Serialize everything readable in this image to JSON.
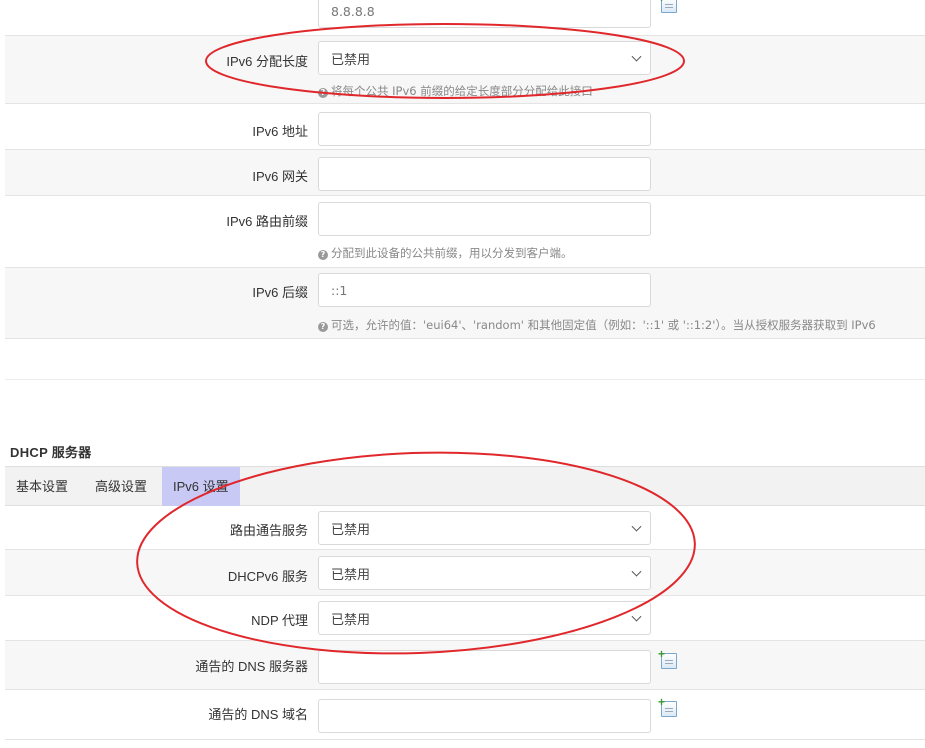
{
  "top_fields": {
    "dns_value": "8.8.8.8",
    "ipv6_assign": {
      "label": "IPv6 分配长度",
      "value": "已禁用",
      "hint": "将每个公共 IPv6 前缀的给定长度部分分配给此接口"
    },
    "ipv6_addr": {
      "label": "IPv6 地址",
      "value": ""
    },
    "ipv6_gw": {
      "label": "IPv6 网关",
      "value": ""
    },
    "ipv6_prefix": {
      "label": "IPv6 路由前缀",
      "value": "",
      "hint": "分配到此设备的公共前缀，用以分发到客户端。"
    },
    "ipv6_suffix": {
      "label": "IPv6 后缀",
      "value": "::1",
      "hint": "可选，允许的值：'eui64'、'random' 和其他固定值（例如：'::1' 或 '::1:2'）。当从授权服务器获取到 IPv6"
    }
  },
  "dhcp": {
    "title": "DHCP 服务器",
    "tabs": [
      "基本设置",
      "高级设置",
      "IPv6 设置"
    ],
    "active_tab": "IPv6 设置",
    "ra_service": {
      "label": "路由通告服务",
      "value": "已禁用"
    },
    "dhcpv6_service": {
      "label": "DHCPv6 服务",
      "value": "已禁用"
    },
    "ndp_proxy": {
      "label": "NDP 代理",
      "value": "已禁用"
    },
    "announced_dns": {
      "label": "通告的 DNS 服务器",
      "value": ""
    },
    "announced_domain": {
      "label": "通告的 DNS 域名",
      "value": ""
    }
  },
  "icons": {
    "hint": "question-circle-icon",
    "add": "add-entry-icon",
    "dropdown": "chevron-down-icon"
  },
  "colors": {
    "annotation": "#e0282c",
    "active_tab": "#c9c9f5",
    "row_alt": "#f7f7f7"
  }
}
